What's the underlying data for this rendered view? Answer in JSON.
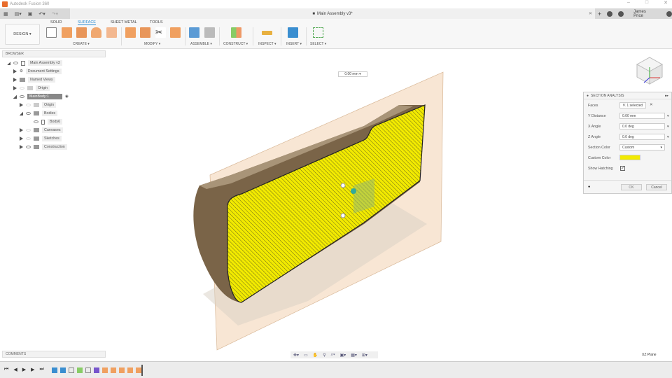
{
  "app_title": "Autodesk Fusion 360",
  "document_tab": "Main Assembly v3*",
  "user": "James Price",
  "workspace": "DESIGN",
  "toolbar_tabs": [
    "SOLID",
    "SURFACE",
    "SHEET METAL",
    "TOOLS"
  ],
  "active_tab": "SURFACE",
  "groups": [
    "CREATE",
    "MODIFY",
    "ASSEMBLE",
    "CONSTRUCT",
    "INSPECT",
    "INSERT",
    "SELECT"
  ],
  "browser": {
    "title": "BROWSER",
    "items": [
      "Main Assembly v3",
      "Document Settings",
      "Named Views",
      "Origin",
      "MainBody:1",
      "Origin",
      "Bodies",
      "Body6",
      "Canvases",
      "Sketches",
      "Construction"
    ]
  },
  "comments": "COMMENTS",
  "distance_readout": "0.00 mm",
  "section_analysis": {
    "title": "SECTION ANALYSIS",
    "faces_label": "Faces",
    "faces_value": "1 selected",
    "y_label": "Y Distance",
    "y_value": "0.00 mm",
    "x_label": "X Angle",
    "x_value": "0.0 deg",
    "z_label": "Z Angle",
    "z_value": "0.0 deg",
    "color_label": "Section Color",
    "color_value": "Custom",
    "custom_label": "Custom Color",
    "custom_color": "#f2ea00",
    "hatch_label": "Show Hatching",
    "hatch_checked": true,
    "ok": "OK",
    "cancel": "Cancel"
  },
  "plane_label": "XZ Plane",
  "accent": "#2a8dd4"
}
